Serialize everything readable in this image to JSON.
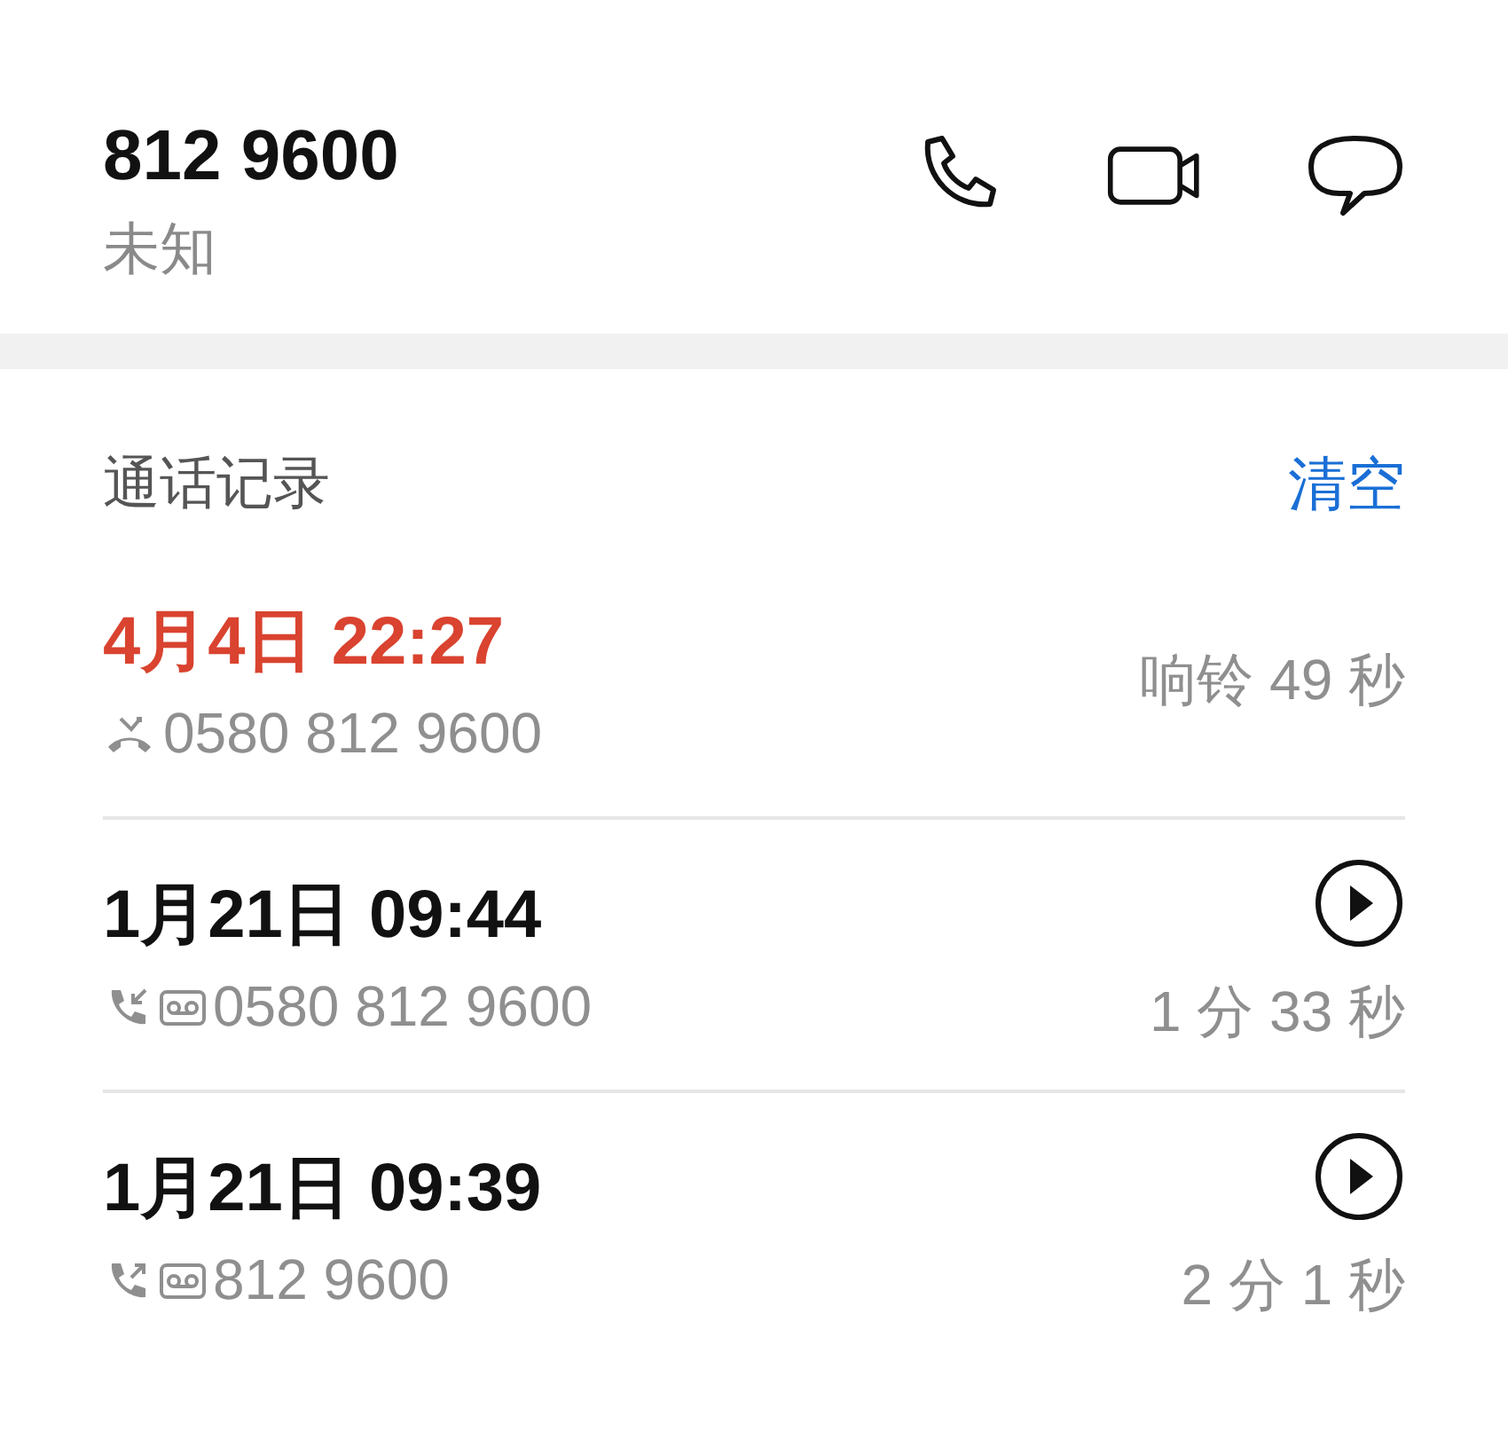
{
  "contact": {
    "number": "812 9600",
    "label": "未知"
  },
  "history": {
    "title": "通话记录",
    "clear": "清空"
  },
  "calls": [
    {
      "time": "4月4日 22:27",
      "kind": "missed",
      "voicemail": false,
      "recording": false,
      "number": "0580 812 9600",
      "duration": "响铃 49 秒"
    },
    {
      "time": "1月21日 09:44",
      "kind": "incoming",
      "voicemail": true,
      "recording": true,
      "number": "0580 812 9600",
      "duration": "1 分 33 秒"
    },
    {
      "time": "1月21日 09:39",
      "kind": "outgoing",
      "voicemail": true,
      "recording": true,
      "number": "812 9600",
      "duration": "2 分 1 秒"
    }
  ]
}
